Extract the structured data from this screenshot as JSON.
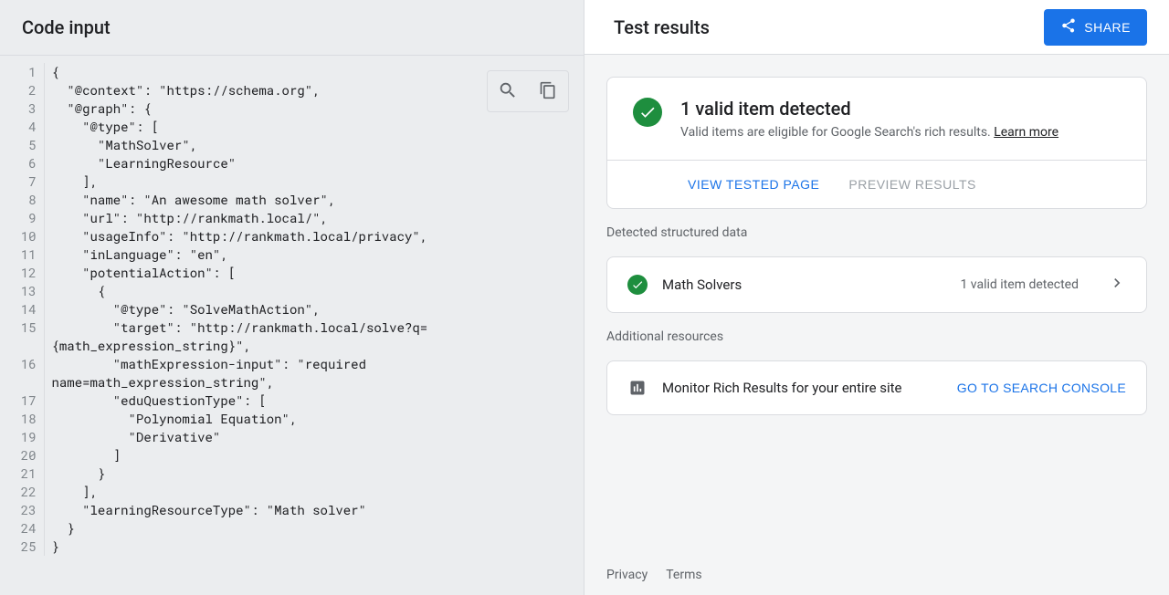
{
  "left": {
    "title": "Code input",
    "toolbar": {
      "search": "search-icon",
      "copy": "copy-icon"
    },
    "code_lines": [
      "{",
      "  \"@context\": \"https://schema.org\",",
      "  \"@graph\": {",
      "    \"@type\": [",
      "      \"MathSolver\",",
      "      \"LearningResource\"",
      "    ],",
      "    \"name\": \"An awesome math solver\",",
      "    \"url\": \"http://rankmath.local/\",",
      "    \"usageInfo\": \"http://rankmath.local/privacy\",",
      "    \"inLanguage\": \"en\",",
      "    \"potentialAction\": [",
      "      {",
      "        \"@type\": \"SolveMathAction\",",
      "        \"target\": \"http://rankmath.local/solve?q={math_expression_string}\",",
      "        \"mathExpression-input\": \"required name=math_expression_string\",",
      "        \"eduQuestionType\": [",
      "          \"Polynomial Equation\",",
      "          \"Derivative\"",
      "        ]",
      "      }",
      "    ],",
      "    \"learningResourceType\": \"Math solver\"",
      "  }",
      "}"
    ]
  },
  "right": {
    "title": "Test results",
    "share_label": "SHARE",
    "summary": {
      "heading": "1 valid item detected",
      "subtext": "Valid items are eligible for Google Search's rich results. ",
      "learn_more": "Learn more"
    },
    "actions": {
      "view_tested": "VIEW TESTED PAGE",
      "preview": "PREVIEW RESULTS"
    },
    "detected_label": "Detected structured data",
    "detected_item": {
      "name": "Math Solvers",
      "status": "1 valid item detected"
    },
    "resources_label": "Additional resources",
    "resource_item": {
      "text": "Monitor Rich Results for your entire site",
      "cta": "GO TO SEARCH CONSOLE"
    },
    "footer": {
      "privacy": "Privacy",
      "terms": "Terms"
    }
  }
}
